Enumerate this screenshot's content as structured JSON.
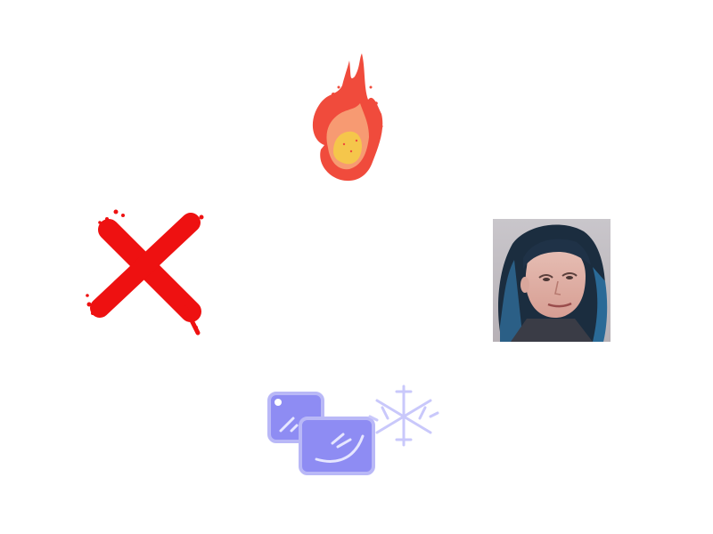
{
  "scene": {
    "background": "#ffffff",
    "sprites": [
      {
        "name": "fire-icon",
        "kind": "fireball",
        "colors": [
          "#f04b3c",
          "#f79a72",
          "#f5c64b"
        ]
      },
      {
        "name": "close-icon",
        "kind": "red-x",
        "colors": [
          "#ee1111"
        ]
      },
      {
        "name": "ice-icon",
        "kind": "ice-cubes-snowflake",
        "colors": [
          "#8e8cf3",
          "#b9b8f7",
          "#c9c8fb"
        ]
      },
      {
        "name": "avatar",
        "kind": "player-photo"
      }
    ]
  }
}
